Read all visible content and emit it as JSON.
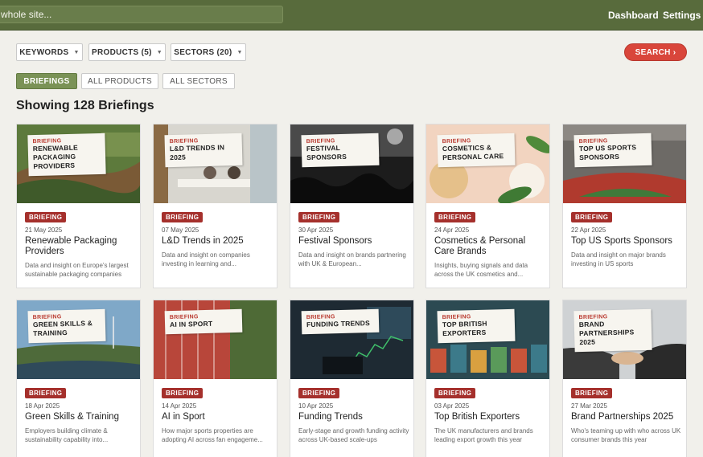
{
  "header": {
    "search_placeholder": "whole site...",
    "links": {
      "dashboard": "Dashboard",
      "settings": "Settings"
    }
  },
  "filters": {
    "keywords": "KEYWORDS",
    "products": "PRODUCTS (5)",
    "sectors": "SECTORS (20)",
    "search": "SEARCH",
    "search_arrow": "›"
  },
  "tabs": {
    "briefings": "BRIEFINGS",
    "all_products": "ALL PRODUCTS",
    "all_sectors": "ALL SECTORS"
  },
  "heading": "Showing 128 Briefings",
  "cards": [
    {
      "overlay_label": "BRIEFING",
      "overlay_title": "RENEWABLE PACKAGING PROVIDERS",
      "badge": "BRIEFING",
      "date": "21 May 2025",
      "title": "Renewable Packaging Providers",
      "desc": "Data and insight on Europe's largest sustainable packaging companies"
    },
    {
      "overlay_label": "BRIEFING",
      "overlay_title": "L&D TRENDS IN 2025",
      "badge": "BRIEFING",
      "date": "07 May 2025",
      "title": "L&D Trends in 2025",
      "desc": "Data and insight on companies investing in learning and..."
    },
    {
      "overlay_label": "BRIEFING",
      "overlay_title": "FESTIVAL SPONSORS",
      "badge": "BRIEFING",
      "date": "30 Apr 2025",
      "title": "Festival Sponsors",
      "desc": "Data and insight on brands partnering with UK & European..."
    },
    {
      "overlay_label": "BRIEFING",
      "overlay_title": "COSMETICS & PERSONAL CARE",
      "badge": "BRIEFING",
      "date": "24 Apr 2025",
      "title": "Cosmetics & Personal Care Brands",
      "desc": "Insights, buying signals and data across the UK cosmetics and..."
    },
    {
      "overlay_label": "BRIEFING",
      "overlay_title": "TOP US SPORTS SPONSORS",
      "badge": "BRIEFING",
      "date": "22 Apr 2025",
      "title": "Top US Sports Sponsors",
      "desc": "Data and insight on major brands investing in US sports"
    },
    {
      "overlay_label": "BRIEFING",
      "overlay_title": "GREEN SKILLS & TRAINING",
      "badge": "BRIEFING",
      "date": "18 Apr 2025",
      "title": "Green Skills & Training",
      "desc": "Employers building climate & sustainability capability into..."
    },
    {
      "overlay_label": "BRIEFING",
      "overlay_title": "AI IN SPORT",
      "badge": "BRIEFING",
      "date": "14 Apr 2025",
      "title": "AI in Sport",
      "desc": "How major sports properties are adopting AI across fan engageme..."
    },
    {
      "overlay_label": "BRIEFING",
      "overlay_title": "FUNDING TRENDS",
      "badge": "BRIEFING",
      "date": "10 Apr 2025",
      "title": "Funding Trends",
      "desc": "Early-stage and growth funding activity across UK-based scale-ups"
    },
    {
      "overlay_label": "BRIEFING",
      "overlay_title": "TOP BRITISH EXPORTERS",
      "badge": "BRIEFING",
      "date": "03 Apr 2025",
      "title": "Top British Exporters",
      "desc": "The UK manufacturers and brands leading export growth this year"
    },
    {
      "overlay_label": "BRIEFING",
      "overlay_title": "BRAND PARTNERSHIPS 2025",
      "badge": "BRIEFING",
      "date": "27 Mar 2025",
      "title": "Brand Partnerships 2025",
      "desc": "Who's teaming up with who across UK consumer brands this year"
    }
  ]
}
